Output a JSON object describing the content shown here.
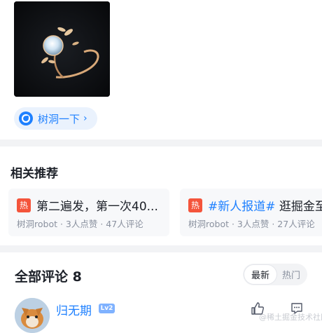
{
  "post": {
    "image_alt": "ring photo",
    "shudong": {
      "label": "树洞一下",
      "chevron": "›"
    }
  },
  "related": {
    "title": "相关推荐",
    "cards": [
      {
        "badge": "热",
        "title": "第二遍发，第一次40...",
        "author": "树洞robot",
        "likes": "3人点赞",
        "comments": "47人评论"
      },
      {
        "badge": "热",
        "tag": "#新人报道#",
        "title": " 逛掘金至",
        "author": "树洞robot",
        "likes": "3人点赞",
        "comments": "27人评论"
      }
    ]
  },
  "comments": {
    "title": "全部评论 8",
    "sort_tabs": [
      "最新",
      "热门"
    ],
    "first": {
      "author": "归无期",
      "level": "Lv2"
    }
  },
  "watermark": "@稀土掘金技术社区",
  "icons": [
    "shudong-logo-icon",
    "like-icon",
    "comment-icon"
  ],
  "colors": {
    "accent": "#1e80ff",
    "hot": "#f4543b",
    "card_bg": "#f7f8fa"
  }
}
